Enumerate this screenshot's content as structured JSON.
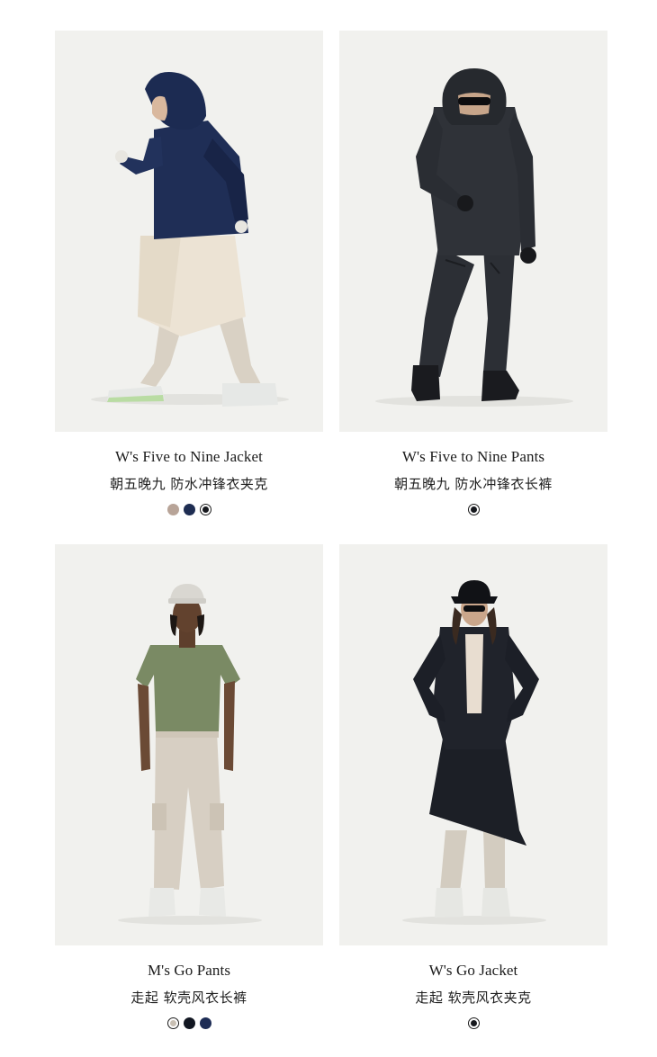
{
  "products": [
    {
      "name_en": "W's Five to Nine Jacket",
      "name_cn": "朝五晚九 防水冲锋衣夹克",
      "swatches": [
        {
          "color": "#b8a498",
          "selected": false
        },
        {
          "color": "#1e2d52",
          "selected": false
        },
        {
          "color": "#16181d",
          "selected": true
        }
      ]
    },
    {
      "name_en": "W's Five to Nine Pants",
      "name_cn": "朝五晚九 防水冲锋衣长裤",
      "swatches": [
        {
          "color": "#16181d",
          "selected": true
        }
      ]
    },
    {
      "name_en": "M's Go Pants",
      "name_cn": "走起 软壳风衣长裤",
      "swatches": [
        {
          "color": "#c8bfb3",
          "selected": true
        },
        {
          "color": "#121722",
          "selected": false
        },
        {
          "color": "#1d2c55",
          "selected": false
        }
      ]
    },
    {
      "name_en": "W's Go Jacket",
      "name_cn": "走起 软壳风衣夹克",
      "swatches": [
        {
          "color": "#16181d",
          "selected": true
        }
      ]
    }
  ],
  "colors": {
    "photo_background": "#f1f1ee",
    "text": "#1c1c1c"
  }
}
